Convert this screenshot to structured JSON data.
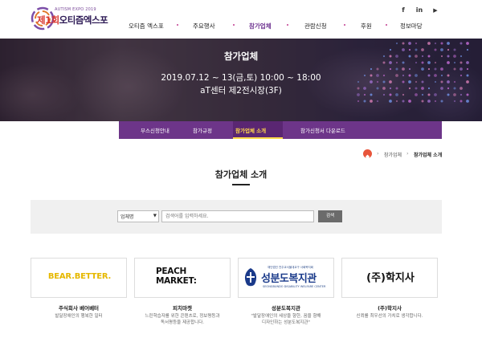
{
  "header": {
    "logo_small": "AUTISM EXPO 2019",
    "logo_red": "제1회",
    "logo_main": "오티즘엑스포",
    "nav": [
      "오티즘 엑스포",
      "주요행사",
      "참가업체",
      "관람신청",
      "후원",
      "정보마당"
    ],
    "active_nav": "참가업체",
    "social": [
      {
        "name": "facebook-icon",
        "glyph": "f"
      },
      {
        "name": "linkedin-icon",
        "glyph": "in"
      },
      {
        "name": "youtube-icon",
        "glyph": "▶"
      }
    ]
  },
  "hero": {
    "title": "참가업체",
    "date": "2019.07.12 ~ 13(금,토) 10:00 ~ 18:00",
    "place": "aT센터 제2전시장(3F)"
  },
  "subnav": {
    "items": [
      "부스신청안내",
      "참가규정",
      "참가업체 소개",
      "참가신청서 다운로드"
    ],
    "active": "참가업체 소개"
  },
  "breadcrumb": {
    "items": [
      "참가업체",
      "참가업체 소개"
    ]
  },
  "page": {
    "title": "참가업체 소개"
  },
  "search": {
    "select_value": "업체명",
    "placeholder": "검색어를 입력하세요.",
    "button_label": "검색"
  },
  "companies": [
    {
      "logo": "BEAR.BETTER.",
      "name": "주식회사 베어베터",
      "desc": [
        "발달장애인의 행복한 일터"
      ]
    },
    {
      "logo": [
        "PEACH",
        "MARKET:"
      ],
      "name": "피치마켓",
      "desc": [
        "느린학습자를 위한 콘텐츠로, 정보평등과",
        "독서평등을 제공합니다."
      ]
    },
    {
      "logo_small": "재단법인 천주교서울대교구 사회복지회",
      "logo": "성분도복지관",
      "logo_eng": "SEONGBUNDO DISABILITY WELFARE CENTER",
      "name": "성분도복지관",
      "desc": [
        "\"발달장애인의 세상을 향한, 꿈을 향해",
        "디자인하는 성분도복지관\""
      ]
    },
    {
      "logo": "(주)학지사",
      "name": "(주)학지사",
      "desc": [
        "신뢰를 최우선의 가치로 생각합니다."
      ]
    }
  ],
  "colors": {
    "accent": "#6d3589",
    "active_sub": "#ffd84a",
    "bear_yellow": "#e6b800",
    "peach_red": "#e83a4a",
    "seongbundo_blue": "#1a3a8a",
    "home_orange": "#e8553b"
  }
}
